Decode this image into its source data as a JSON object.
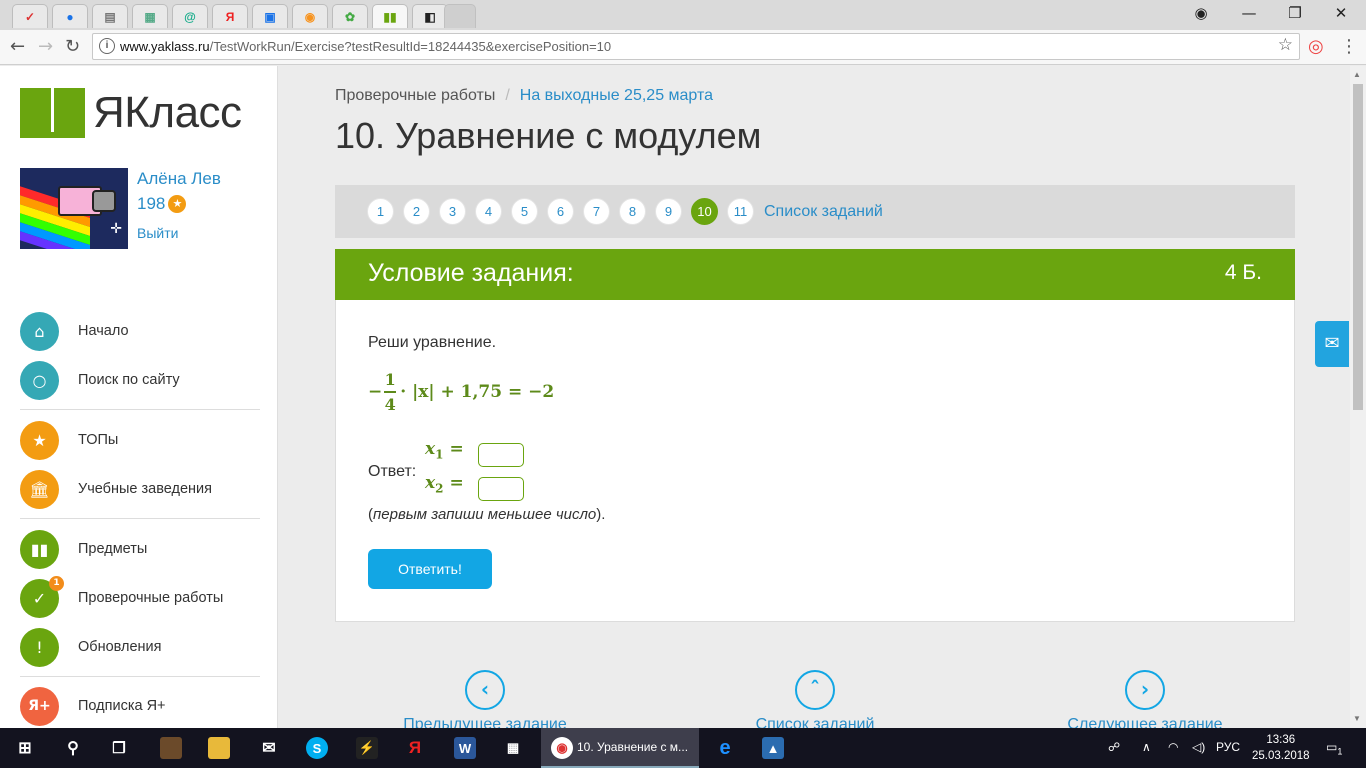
{
  "browser": {
    "url_domain": "www.yaklass.ru",
    "url_path": "/TestWorkRun/Exercise?testResultId=18244435&exercisePosition=10",
    "info_icon": "i"
  },
  "logo": {
    "text": "ЯКласс"
  },
  "user": {
    "name": "Алёна Лев",
    "score": "198",
    "logout": "Выйти"
  },
  "menu": [
    {
      "label": "Начало",
      "icon": "home-icon"
    },
    {
      "label": "Поиск по сайту",
      "icon": "search-icon"
    },
    {
      "label": "ТОПы",
      "icon": "star-icon"
    },
    {
      "label": "Учебные заведения",
      "icon": "building-icon"
    },
    {
      "label": "Предметы",
      "icon": "book-icon"
    },
    {
      "label": "Проверочные работы",
      "icon": "check-icon",
      "badge": "1"
    },
    {
      "label": "Обновления",
      "icon": "exclamation-icon"
    },
    {
      "label": "Подписка Я+",
      "icon": "yaplus-icon",
      "icon_text": "Я+"
    }
  ],
  "breadcrumb": {
    "root": "Проверочные работы",
    "sep": "/",
    "current": "На выходные 25,25 марта"
  },
  "page_title": "10. Уравнение с модулем",
  "task_numbers": [
    "1",
    "2",
    "3",
    "4",
    "5",
    "6",
    "7",
    "8",
    "9",
    "10",
    "11"
  ],
  "active_task": "10",
  "task_list_link": "Список заданий",
  "task": {
    "header": "Условие задания:",
    "points": "4 Б.",
    "instruction": "Реши уравнение.",
    "equation": {
      "minus": "−",
      "num": "1",
      "den": "4",
      "rest": "· |x| + 1,75 = −2"
    },
    "answer_label": "Ответ:",
    "x1_var": "x",
    "x1_sub": "1",
    "x2_var": "x",
    "x2_sub": "2",
    "eq_sign": "=",
    "hint_open": "(",
    "hint": "первым запиши меньшее число",
    "hint_close": ").",
    "submit": "Ответить!"
  },
  "bottom_nav": {
    "prev": "Предыдущее задание",
    "list": "Список заданий",
    "next": "Следующее задание"
  },
  "taskbar": {
    "active_window": "10. Уравнение с м...",
    "lang": "РУС",
    "time": "13:36",
    "date": "25.03.2018",
    "notif_count": "1"
  },
  "colors": {
    "brand_green": "#6aa50f",
    "link_blue": "#2a8dc8",
    "button_blue": "#12a6e4",
    "math_green": "#5d8a1a"
  }
}
